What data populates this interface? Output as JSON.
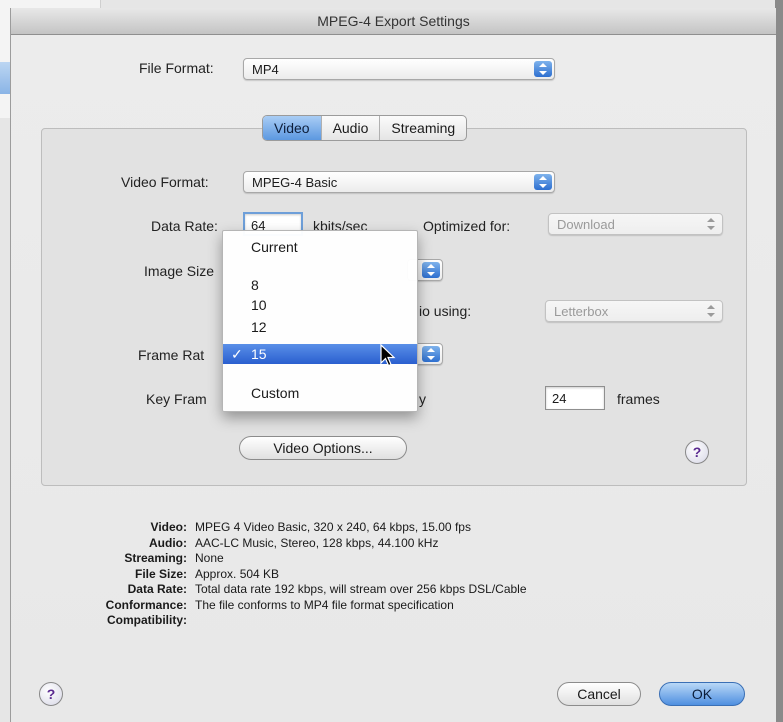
{
  "window": {
    "title": "MPEG-4 Export Settings"
  },
  "file_format": {
    "label": "File Format:",
    "value": "MP4"
  },
  "tabs": [
    {
      "label": "Video",
      "active": true
    },
    {
      "label": "Audio",
      "active": false
    },
    {
      "label": "Streaming",
      "active": false
    }
  ],
  "video": {
    "format_label": "Video Format:",
    "format_value": "MPEG-4 Basic",
    "data_rate_label": "Data Rate:",
    "data_rate_value": "64",
    "data_rate_unit": "kbits/sec",
    "optimized_label": "Optimized for:",
    "optimized_value": "Download",
    "image_size_label": "Image Size",
    "preserve_label": "io using:",
    "preserve_value": "Letterbox",
    "frame_rate_label": "Frame Rat",
    "key_frame_label": "Key Fram",
    "key_frame_suffix_label": "y",
    "key_frame_value": "24",
    "key_frame_unit": "frames",
    "video_options_label": "Video Options..."
  },
  "frame_rate_menu": {
    "items": [
      {
        "label": "Current",
        "selected": false
      },
      {
        "label": "8",
        "selected": false
      },
      {
        "label": "10",
        "selected": false
      },
      {
        "label": "12",
        "selected": false
      },
      {
        "label": "15",
        "selected": true
      },
      {
        "label": "Custom",
        "selected": false
      }
    ],
    "check_mark": "✓"
  },
  "summary": [
    {
      "key": "Video:",
      "value": "MPEG 4 Video Basic, 320 x 240, 64 kbps, 15.00 fps"
    },
    {
      "key": "Audio:",
      "value": "AAC-LC Music, Stereo, 128 kbps, 44.100 kHz"
    },
    {
      "key": "Streaming:",
      "value": "None"
    },
    {
      "key": "File Size:",
      "value": "Approx. 504 KB"
    },
    {
      "key": "Data Rate:",
      "value": "Total data rate 192 kbps, will stream over 256 kbps DSL/Cable"
    },
    {
      "key": "Conformance:",
      "value": "The file conforms to MP4 file format specification"
    },
    {
      "key": "Compatibility:",
      "value": ""
    }
  ],
  "buttons": {
    "help": "?",
    "cancel": "Cancel",
    "ok": "OK"
  },
  "colors": {
    "accent": "#4f8fe0",
    "menu_highlight": "#2a5fcf",
    "help_glyph": "#5a2a90"
  },
  "icons": [
    "popup-arrows-icon",
    "help-icon",
    "checkmark-icon",
    "mouse-pointer-icon"
  ]
}
